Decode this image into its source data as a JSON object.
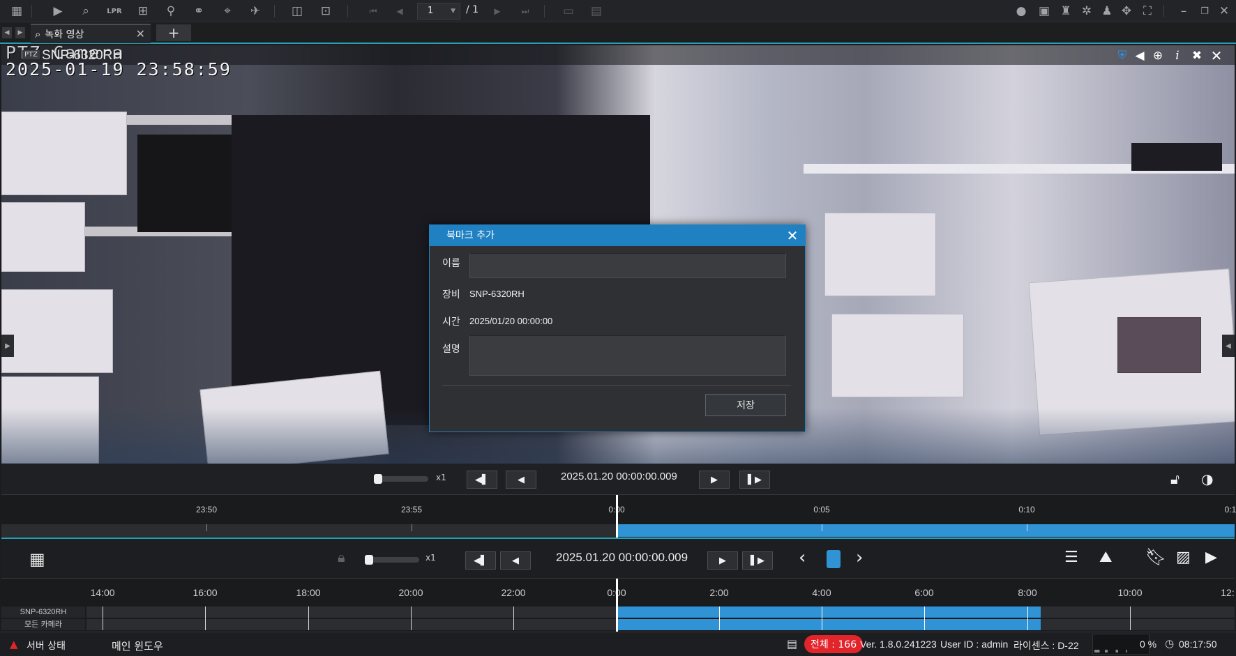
{
  "toolbar": {
    "left_icons": [
      "grid-icon",
      "play-icon",
      "search-video-icon",
      "lpr-icon",
      "layout-grid-icon",
      "person-search-icon",
      "bike-icon",
      "map-icon",
      "alarm-icon",
      "split-view-icon",
      "add-screen-icon"
    ],
    "page": {
      "current": "1",
      "total": "/ 1"
    },
    "right_icons": [
      "chat-icon",
      "monitor-icon",
      "bell-icon",
      "gear-icon",
      "user-icon",
      "move-icon",
      "fullscreen-icon",
      "minimize-icon",
      "restore-icon",
      "close-icon"
    ]
  },
  "tabs": {
    "active_label": "녹화 영상",
    "add_label": "+"
  },
  "video": {
    "camera_name": "SNP-6320RH",
    "osd_title": "PTZ Camera",
    "osd_time": "2025-01-19  23:58:59"
  },
  "dialog": {
    "title": "북마크 추가",
    "name_label": "이름",
    "name_value": "",
    "device_label": "장비",
    "device_value": "SNP-6320RH",
    "time_label": "시간",
    "time_value": "2025/01/20 00:00:00",
    "desc_label": "설명",
    "desc_value": "",
    "save_label": "저장"
  },
  "playback1": {
    "speed": "x1",
    "time": "2025.01.20 00:00:00.009",
    "ticks": [
      "23:50",
      "23:55",
      "0:00",
      "0:05",
      "0:10",
      "0:1"
    ]
  },
  "playback2": {
    "speed": "x1",
    "time": "2025.01.20 00:00:00.009",
    "ticks": [
      "14:00",
      "16:00",
      "18:00",
      "20:00",
      "22:00",
      "0:00",
      "2:00",
      "4:00",
      "6:00",
      "8:00",
      "10:00",
      "12:"
    ],
    "rows": [
      "SNP-6320RH",
      "모든 카메라"
    ]
  },
  "status": {
    "server_status": "서버 상태",
    "main_window": "메인 윈도우",
    "total": "전체 : 166",
    "version": "Ver. 1.8.0.241223",
    "user": "User ID : admin",
    "license": "라이센스 : D-22",
    "cpu": "0 %",
    "clock": "08:17:50"
  },
  "colors": {
    "accent": "#1f80c2",
    "timeline_fill": "#2f93d6",
    "alert": "#e2242b"
  }
}
